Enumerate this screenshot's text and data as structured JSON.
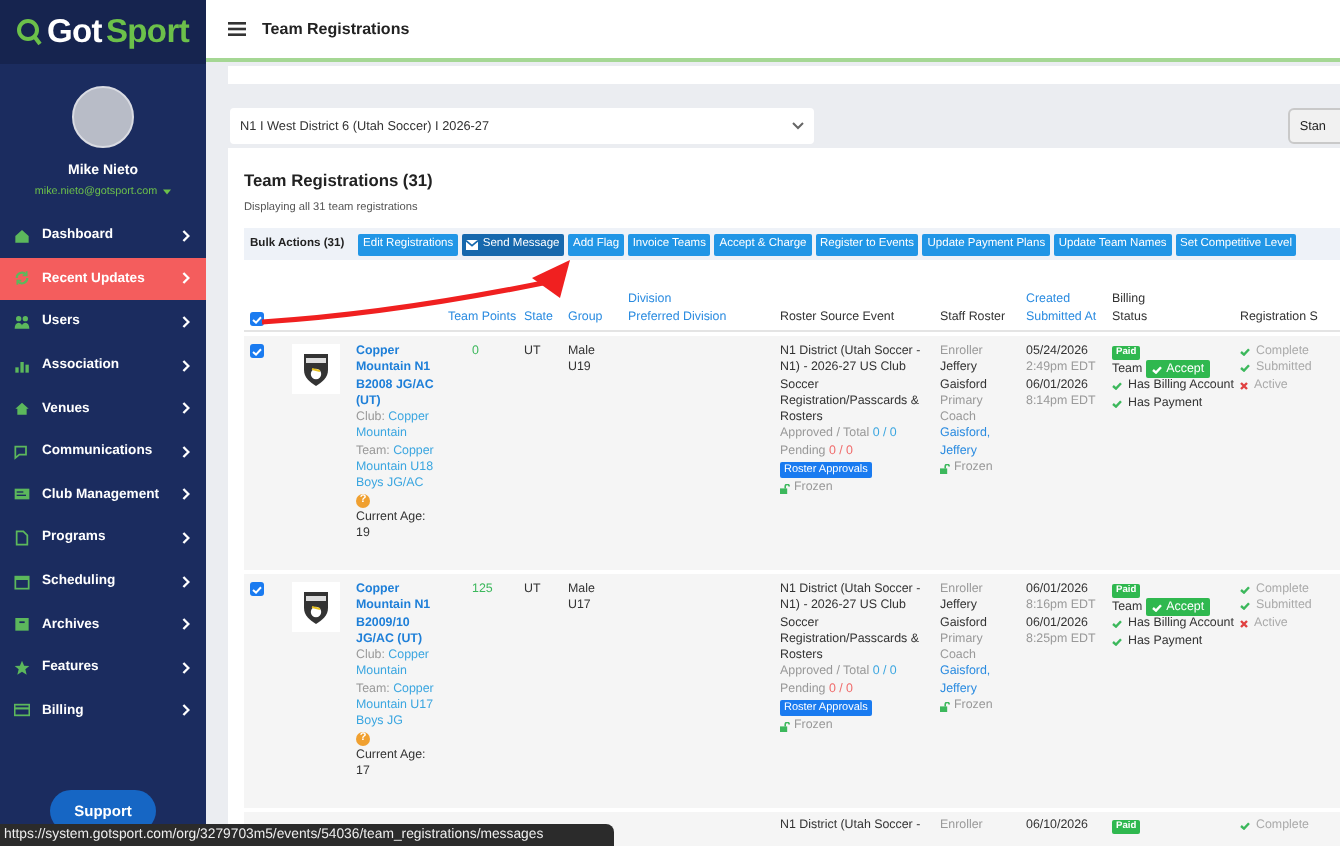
{
  "sidebar": {
    "logo": {
      "part_1": "Got",
      "part_2": "Sport"
    },
    "user": {
      "name": "Mike Nieto",
      "email": "mike.nieto@gotsport.com"
    },
    "items": [
      {
        "label": "Dashboard",
        "selected": false
      },
      {
        "label": "Recent Updates",
        "selected": true
      },
      {
        "label": "Users",
        "selected": false
      },
      {
        "label": "Association",
        "selected": false
      },
      {
        "label": "Venues",
        "selected": false
      },
      {
        "label": "Communications",
        "selected": false
      },
      {
        "label": "Club Management",
        "selected": false
      },
      {
        "label": "Programs",
        "selected": false
      },
      {
        "label": "Scheduling",
        "selected": false
      },
      {
        "label": "Archives",
        "selected": false
      },
      {
        "label": "Features",
        "selected": false
      },
      {
        "label": "Billing",
        "selected": false
      }
    ],
    "support": "Support"
  },
  "topbar": {
    "title": "Team Registrations"
  },
  "filter": {
    "event": "N1 I West District 6 (Utah Soccer) I 2026-27",
    "button": "Stan"
  },
  "registrations": {
    "title": "Team Registrations (31)",
    "subtitle": "Displaying all 31 team registrations",
    "bulk_label": "Bulk Actions (31)",
    "actions": [
      {
        "label": "Edit Registrations",
        "selected": false
      },
      {
        "label": "Send Message",
        "selected": true
      },
      {
        "label": "Add Flag",
        "selected": false
      },
      {
        "label": "Invoice Teams",
        "selected": false
      },
      {
        "label": "Accept & Charge",
        "selected": false
      },
      {
        "label": "Register to Events",
        "selected": false
      },
      {
        "label": "Update Payment Plans",
        "selected": false
      },
      {
        "label": "Update Team Names",
        "selected": false
      },
      {
        "label": "Set Competitive Level",
        "selected": false
      }
    ],
    "table": {
      "select_all_checked": true,
      "columns": [
        {
          "label": "Team Points",
          "link": true
        },
        {
          "label": "State",
          "link": true
        },
        {
          "label": "Group",
          "link": true
        },
        {
          "label": "Division",
          "label_2": "Preferred Division",
          "link": true
        },
        {
          "label": "Roster Source Event",
          "link": false
        },
        {
          "label": "Staff Roster",
          "link": false
        },
        {
          "label": "Created",
          "label_2": "Submitted At",
          "link": true
        },
        {
          "label": "Billing",
          "label_2": "Status",
          "link": false
        },
        {
          "label": "Registration S",
          "link": false
        }
      ],
      "rows": [
        {
          "checked": true,
          "team_name": "Copper Mountain N1 B2008 JG/AC (UT)",
          "club_label": "Club:",
          "club": "Copper Mountain",
          "team_label": "Team:",
          "team": "Copper Mountain U18 Boys JG/AC",
          "warning": "?",
          "age_label": "Current Age:",
          "age": "19",
          "points": "0",
          "state": "UT",
          "group": "Male U19",
          "roster_event": "N1 District (Utah Soccer - N1) - 2026-27 US Club Soccer Registration/Passcards & Rosters",
          "approved_label": "Approved / Total",
          "approved": "0 / 0",
          "pending_label": "Pending",
          "pending": "0 / 0",
          "roster_button": "Roster Approvals",
          "roster_frozen": "Frozen",
          "enroller_label": "Enroller",
          "enroller": "Jeffery Gaisford",
          "coach_label": "Primary Coach",
          "coach": "Gaisford, Jeffery",
          "staff_frozen": "Frozen",
          "created_date": "05/24/2026",
          "created_time": "2:49pm EDT",
          "submitted_date": "06/01/2026",
          "submitted_time": "8:14pm EDT",
          "paid": "Paid",
          "billing_label": "Team",
          "accept": "Accept",
          "billing_checks": [
            "Has Billing Account",
            "Has Payment"
          ],
          "registration": [
            {
              "label": "Complete",
              "done": true
            },
            {
              "label": "Submitted",
              "done": true
            },
            {
              "label": "Active",
              "done": false
            }
          ]
        },
        {
          "checked": true,
          "team_name": "Copper Mountain N1 B2009/10 JG/AC (UT)",
          "club_label": "Club:",
          "club": "Copper Mountain",
          "team_label": "Team:",
          "team": "Copper Mountain U17 Boys JG",
          "warning": "?",
          "age_label": "Current Age:",
          "age": "17",
          "points": "125",
          "state": "UT",
          "group": "Male U17",
          "roster_event": "N1 District (Utah Soccer - N1) - 2026-27 US Club Soccer Registration/Passcards & Rosters",
          "approved_label": "Approved / Total",
          "approved": "0 / 0",
          "pending_label": "Pending",
          "pending": "0 / 0",
          "roster_button": "Roster Approvals",
          "roster_frozen": "Frozen",
          "enroller_label": "Enroller",
          "enroller": "Jeffery Gaisford",
          "coach_label": "Primary Coach",
          "coach": "Gaisford, Jeffery",
          "staff_frozen": "Frozen",
          "created_date": "06/01/2026",
          "created_time": "8:16pm EDT",
          "submitted_date": "06/01/2026",
          "submitted_time": "8:25pm EDT",
          "paid": "Paid",
          "billing_label": "Team",
          "accept": "Accept",
          "billing_checks": [
            "Has Billing Account",
            "Has Payment"
          ],
          "registration": [
            {
              "label": "Complete",
              "done": true
            },
            {
              "label": "Submitted",
              "done": true
            },
            {
              "label": "Active",
              "done": false
            }
          ]
        }
      ],
      "partial_row": {
        "roster_event": "N1 District (Utah Soccer -",
        "enroller_label": "Enroller",
        "created_date": "06/10/2026",
        "paid": "Paid",
        "status": {
          "label": "Complete",
          "done": true
        }
      }
    }
  },
  "status_url": "https://system.gotsport.com/org/3279703m5/events/54036/team_registrations/messages"
}
